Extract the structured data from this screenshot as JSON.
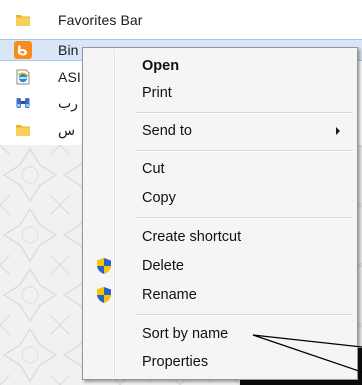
{
  "favorites": {
    "items": [
      {
        "label": "Favorites Bar",
        "icon": "folder-icon"
      },
      {
        "label": "Bin",
        "icon": "bing-icon",
        "selected": true
      },
      {
        "label": "ASI",
        "icon": "ie-page-icon"
      },
      {
        "label": "رب",
        "icon": "feed-binoculars-icon"
      },
      {
        "label": "س",
        "icon": "folder-icon"
      }
    ]
  },
  "context_menu": {
    "open": "Open",
    "print": "Print",
    "send_to": "Send to",
    "cut": "Cut",
    "copy": "Copy",
    "create_shortcut": "Create shortcut",
    "delete": "Delete",
    "rename": "Rename",
    "sort_by_name": "Sort by name",
    "properties": "Properties"
  },
  "colors": {
    "selection": "#d8e6f8",
    "menu_bg": "#f5f5f5",
    "bing_orange": "#f68b1f",
    "folder_yellow": "#f5c342",
    "shield_blue": "#2b62c9",
    "shield_yellow": "#f5c600"
  }
}
